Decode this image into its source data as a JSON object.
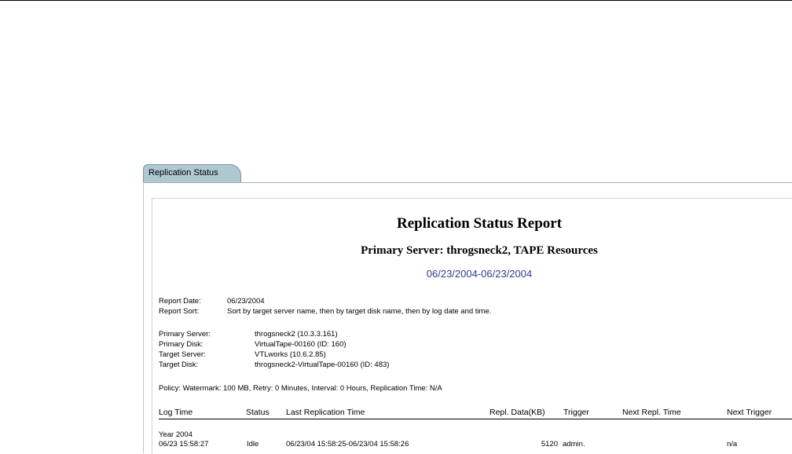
{
  "tab": {
    "label": "Replication Status"
  },
  "report": {
    "title": "Replication Status Report",
    "subtitle": "Primary Server: throgsneck2, TAPE Resources",
    "date_range": "06/23/2004-06/23/2004"
  },
  "meta": {
    "report_date_label": "Report Date:",
    "report_date_value": "06/23/2004",
    "report_sort_label": "Report Sort:",
    "report_sort_value": "Sort by target server name, then by target disk name, then by log date and time."
  },
  "details": {
    "primary_server_label": "Primary Server:",
    "primary_server_value": "throgsneck2 (10.3.3.161)",
    "primary_disk_label": "Primary Disk:",
    "primary_disk_value": "VirtualTape-00160 (ID: 160)",
    "target_server_label": "Target Server:",
    "target_server_value": "VTLworks (10.6.2.85)",
    "target_disk_label": "Target Disk:",
    "target_disk_value": "throgsneck2-VirtualTape-00160 (ID: 483)"
  },
  "policy": "Policy:  Watermark: 100 MB, Retry: 0 Minutes, Interval: 0 Hours, Replication Time: N/A",
  "table": {
    "headers": [
      "Log Time",
      "Status",
      "Last Replication Time",
      "Repl. Data(KB)",
      "Trigger",
      "Next Repl. Time",
      "Next Trigger"
    ],
    "group_label": "Year 2004",
    "rows": [
      {
        "log_time": "06/23 15:58:27",
        "status": "Idle",
        "last_repl_time": "06/23/04 15:58:25-06/23/04 15:58:26",
        "repl_data": "5120",
        "trigger": "admin.",
        "next_repl_time": "",
        "next_trigger": "n/a"
      }
    ]
  }
}
